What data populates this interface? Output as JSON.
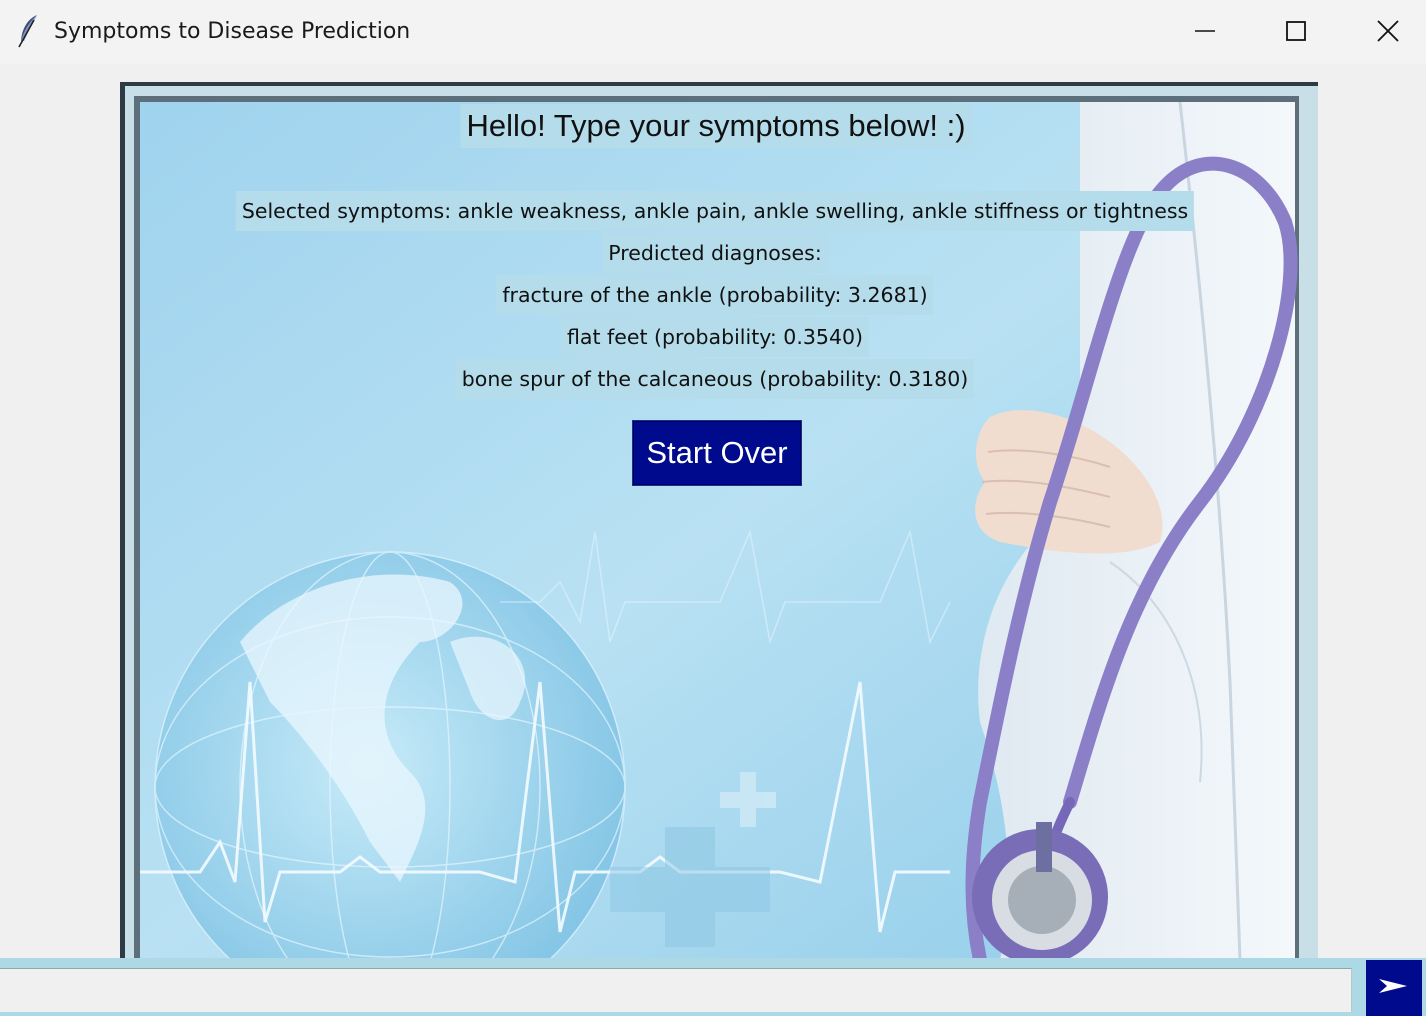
{
  "window": {
    "title": "Symptoms to Disease Prediction",
    "icons": {
      "app": "feather-icon",
      "minimize": "minimize-icon",
      "maximize": "maximize-icon",
      "close": "close-icon"
    }
  },
  "main": {
    "greeting": "Hello! Type your symptoms below! :)",
    "selected_symptoms": "Selected symptoms: ankle weakness, ankle pain, ankle swelling, ankle stiffness or tightness",
    "predicted_header": "Predicted diagnoses:",
    "diagnoses": [
      "fracture of the ankle (probability: 3.2681)",
      "flat feet (probability: 0.3540)",
      "bone spur of the calcaneous (probability: 0.3180)"
    ],
    "start_over_label": "Start Over"
  },
  "input_bar": {
    "value": "",
    "send_icon": "send-arrow-icon"
  },
  "colors": {
    "button_bg": "#000a8c",
    "label_bg": "#b4dcea",
    "input_strip": "#add8e6"
  }
}
